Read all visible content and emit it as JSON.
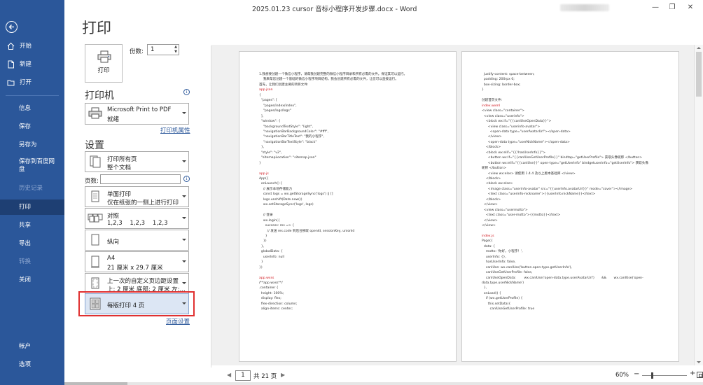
{
  "window": {
    "title": "2025.01.23 cursor 音标小程序开发步骤.docx - Word",
    "minimize": "—",
    "restore": "❐",
    "close": "✕"
  },
  "sidebar": {
    "items": [
      {
        "label": "开始",
        "icon": "home-icon"
      },
      {
        "label": "新建",
        "icon": "new-document-icon"
      },
      {
        "label": "打开",
        "icon": "folder-open-icon"
      },
      {
        "label": "信息"
      },
      {
        "label": "保存"
      },
      {
        "label": "另存为"
      },
      {
        "label": "保存到百度网盘"
      },
      {
        "label": "历史记录"
      },
      {
        "label": "打印"
      },
      {
        "label": "共享"
      },
      {
        "label": "导出"
      },
      {
        "label": "转换"
      },
      {
        "label": "关闭"
      },
      {
        "label": "帐户"
      },
      {
        "label": "选项"
      }
    ],
    "active_item": "打印"
  },
  "print": {
    "title": "打印",
    "print_button": "打印",
    "copies_label": "份数:",
    "copies_value": "1",
    "printer_heading": "打印机",
    "printer_name": "Microsoft Print to PDF",
    "printer_status": "就绪",
    "printer_properties": "打印机属性",
    "settings_heading": "设置",
    "settings": [
      {
        "line1": "打印所有页",
        "line2": "整个文档"
      },
      {
        "line1": "单面打印",
        "line2": "仅在纸张的一侧上进行打印"
      },
      {
        "line1": "对照",
        "line2": "1,2,3    1,2,3    1,2,3"
      },
      {
        "line1": "纵向",
        "line2": ""
      },
      {
        "line1": "A4",
        "line2": "21 厘米 x 29.7 厘米"
      },
      {
        "line1": "上一次的自定义页边距设置",
        "line2": "上: 2 厘米 底部: 2 厘米 左:..."
      },
      {
        "line1": "每版打印 4 页",
        "line2": ""
      }
    ],
    "pages_label": "页数:",
    "page_setup": "页面设置"
  },
  "preview": {
    "page_left": [
      {
        "t": "1.我想要创建一个微信小程序，请帮我创建完整的微信小程序目录和所有必需的文件。保证其可以运行。"
      },
      {
        "t": "    我来帮您创建一个基础的微信小程序项目结构。我会创建所有必需的文件，让您可以直接运行。"
      },
      {
        "t": "首先，让我们创建主要的项目文件:"
      },
      {
        "t": "app.json",
        "red": true
      },
      {
        "t": "{"
      },
      {
        "t": "  \"pages\": ["
      },
      {
        "t": "    \"pages/index/index\","
      },
      {
        "t": "    \"pages/logs/logs\""
      },
      {
        "t": "  ],"
      },
      {
        "t": "  \"window\": {"
      },
      {
        "t": "    \"backgroundTextStyle\": \"light\","
      },
      {
        "t": "    \"navigationBarBackgroundColor\": \"#fff\","
      },
      {
        "t": "    \"navigationBarTitleText\": \"我的小程序\","
      },
      {
        "t": "    \"navigationBarTextStyle\": \"black\""
      },
      {
        "t": "  },"
      },
      {
        "t": "  \"style\": \"v2\","
      },
      {
        "t": "  \"sitemapLocation\": \"sitemap.json\""
      },
      {
        "t": "}"
      },
      {
        "t": ""
      },
      {
        "t": "app.js",
        "red": true
      },
      {
        "t": "App({"
      },
      {
        "t": "  onLaunch() {"
      },
      {
        "t": "    // 展示本地存储能力"
      },
      {
        "t": "    const logs = wx.getStorageSync('logs') || []"
      },
      {
        "t": "    logs.unshift(Date.now())"
      },
      {
        "t": "    wx.setStorageSync('logs', logs)"
      },
      {
        "t": ""
      },
      {
        "t": "    // 登录"
      },
      {
        "t": "    wx.login({"
      },
      {
        "t": "      success: res => {"
      },
      {
        "t": "        // 发送 res.code 到后台换取 openId, sessionKey, unionId"
      },
      {
        "t": "      }"
      },
      {
        "t": "    })"
      },
      {
        "t": "  },"
      },
      {
        "t": "  globalData: {"
      },
      {
        "t": "    userInfo: null"
      },
      {
        "t": "  }"
      },
      {
        "t": "})"
      },
      {
        "t": ""
      },
      {
        "t": "app.wxss",
        "red": true
      },
      {
        "t": "/**app.wxss**/"
      },
      {
        "t": ".container {"
      },
      {
        "t": "  height: 100%;"
      },
      {
        "t": "  display: flex;"
      },
      {
        "t": "  flex-direction: column;"
      },
      {
        "t": "  align-items: center;"
      }
    ],
    "page_right": [
      {
        "t": "  justify-content: space-between;"
      },
      {
        "t": "  padding: 200rpx 0;"
      },
      {
        "t": "  box-sizing: border-box;"
      },
      {
        "t": "}"
      },
      {
        "t": ""
      },
      {
        "t": "创建首页文件:"
      },
      {
        "t": "index.wxml",
        "red": true
      },
      {
        "t": "<view class=\"container\">"
      },
      {
        "t": "  <view class=\"userinfo\">"
      },
      {
        "t": "    <block wx:if=\"{{canIUseOpenData}}\">"
      },
      {
        "t": "      <view class=\"userinfo-avatar\">"
      },
      {
        "t": "        <open-data type=\"userAvatarUrl\"></open-data>"
      },
      {
        "t": "      </view>"
      },
      {
        "t": "      <open-data type=\"userNickName\"></open-data>"
      },
      {
        "t": "    </block>"
      },
      {
        "t": "    <block wx:elif=\"{{!hasUserInfo}}\">"
      },
      {
        "t": "      <button wx:if=\"{{canIUseGetUserProfile}}\" bindtap=\"getUserProfile\"> 获取头像昵称 </button>"
      },
      {
        "t": "      <button wx:elif=\"{{canIUse}}\" open-type=\"getUserInfo\" bindgetuserinfo=\"getUserInfo\"> 获取头像"
      },
      {
        "t": "昵称 </button>"
      },
      {
        "t": "      <view wx:else> 请使用 1.4.4 及以上版本基础库 </view>"
      },
      {
        "t": "    </block>"
      },
      {
        "t": "    <block wx:else>"
      },
      {
        "t": "      <image class=\"userinfo-avatar\" src=\"{{userInfo.avatarUrl}}\" mode=\"cover\"></image>"
      },
      {
        "t": "      <text class=\"userinfo-nickname\">{{userInfo.nickName}}</text>"
      },
      {
        "t": "    </block>"
      },
      {
        "t": "  </view>"
      },
      {
        "t": "  <view class=\"usermotto\">"
      },
      {
        "t": "    <text class=\"user-motto\">{{motto}}</text>"
      },
      {
        "t": "  </view>"
      },
      {
        "t": "</view>"
      },
      {
        "t": ""
      },
      {
        "t": "index.js",
        "red": true
      },
      {
        "t": "Page({"
      },
      {
        "t": "  data: {"
      },
      {
        "t": "    motto: '你好，小程序！',"
      },
      {
        "t": "    userInfo: {},"
      },
      {
        "t": "    hasUserInfo: false,"
      },
      {
        "t": "    canIUse: wx.canIUse('button.open-type.getUserInfo'),"
      },
      {
        "t": "    canIUseGetUserProfile: false,"
      },
      {
        "t": "    canIUseOpenData:        wx.canIUse('open-data.type.userAvatarUrl')       &&       wx.canIUse('open-"
      },
      {
        "t": "data.type.userNickName')"
      },
      {
        "t": "  },"
      },
      {
        "t": "  onLoad() {"
      },
      {
        "t": "    if (wx.getUserProfile) {"
      },
      {
        "t": "      this.setData({"
      },
      {
        "t": "        canIUseGetUserProfile: true"
      }
    ]
  },
  "bottom": {
    "current_page": "1",
    "total_pages": "共 21 页",
    "zoom": "60%",
    "prev_glyph": "◀",
    "next_glyph": "▶",
    "minus": "−",
    "plus": "+"
  },
  "colors": {
    "accent": "#2b579a",
    "highlight_border": "#e03030",
    "code_heading": "#d0181f"
  }
}
